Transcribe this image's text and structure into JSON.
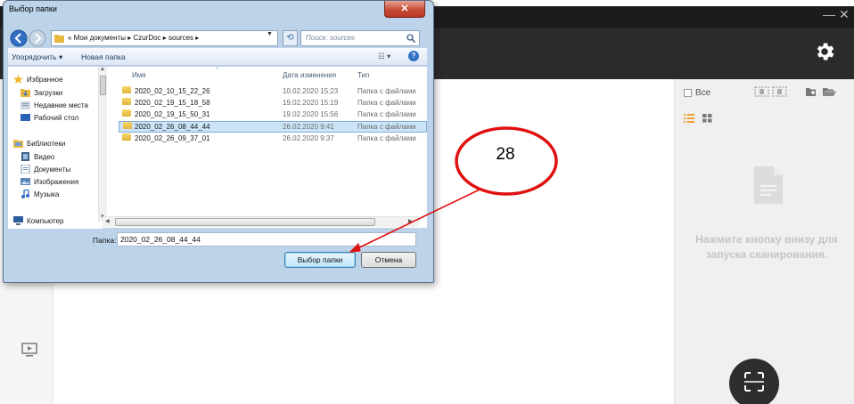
{
  "app": {
    "minimize_glyph": "—",
    "close_glyph": "✕",
    "select_all_label": "Все",
    "hint_text": "Нажмите кнопку внизу для запуска сканирования.",
    "icons": [
      "gear-icon",
      "play-icon",
      "select-pages-icon",
      "import-icon",
      "open-folder-icon",
      "list-view-icon",
      "grid-view-icon",
      "document-icon",
      "scan-icon"
    ]
  },
  "dialog": {
    "title": "Выбор папки",
    "close_glyph": "✕",
    "address": "« Мои документы ▸ CzurDoc ▸ sources ▸",
    "search_placeholder": "Поиск: sources",
    "toolbar": {
      "organize": "Упорядочить ▾",
      "new_folder": "Новая папка",
      "view_glyph": "☷ ▾",
      "help_glyph": "?"
    },
    "nav": {
      "favorites": "Избранное",
      "downloads": "Загрузки",
      "recent": "Недавние места",
      "desktop": "Рабочий стол",
      "libraries": "Библиотеки",
      "video": "Видео",
      "documents": "Документы",
      "pictures": "Изображения",
      "music": "Музыка",
      "computer": "Компьютер"
    },
    "columns": {
      "name": "Имя",
      "date": "Дата изменения",
      "type": "Тип"
    },
    "rows": [
      {
        "name": "2020_02_10_15_22_26",
        "date": "10.02.2020 15:23",
        "type": "Папка с файлами"
      },
      {
        "name": "2020_02_19_15_18_58",
        "date": "19.02.2020 15:19",
        "type": "Папка с файлами"
      },
      {
        "name": "2020_02_19_15_50_31",
        "date": "19.02.2020 15:56",
        "type": "Папка с файлами"
      },
      {
        "name": "2020_02_26_08_44_44",
        "date": "26.02.2020 9:41",
        "type": "Папка с файлами"
      },
      {
        "name": "2020_02_26_09_37_01",
        "date": "26.02.2020 9:37",
        "type": "Папка с файлами"
      }
    ],
    "selected_row": 3,
    "folder_label": "Папка:",
    "folder_value": "2020_02_26_08_44_44",
    "select_button": "Выбор папки",
    "cancel_button": "Отмена"
  },
  "annotation": {
    "callout_number": "28",
    "color": "#e01010"
  }
}
